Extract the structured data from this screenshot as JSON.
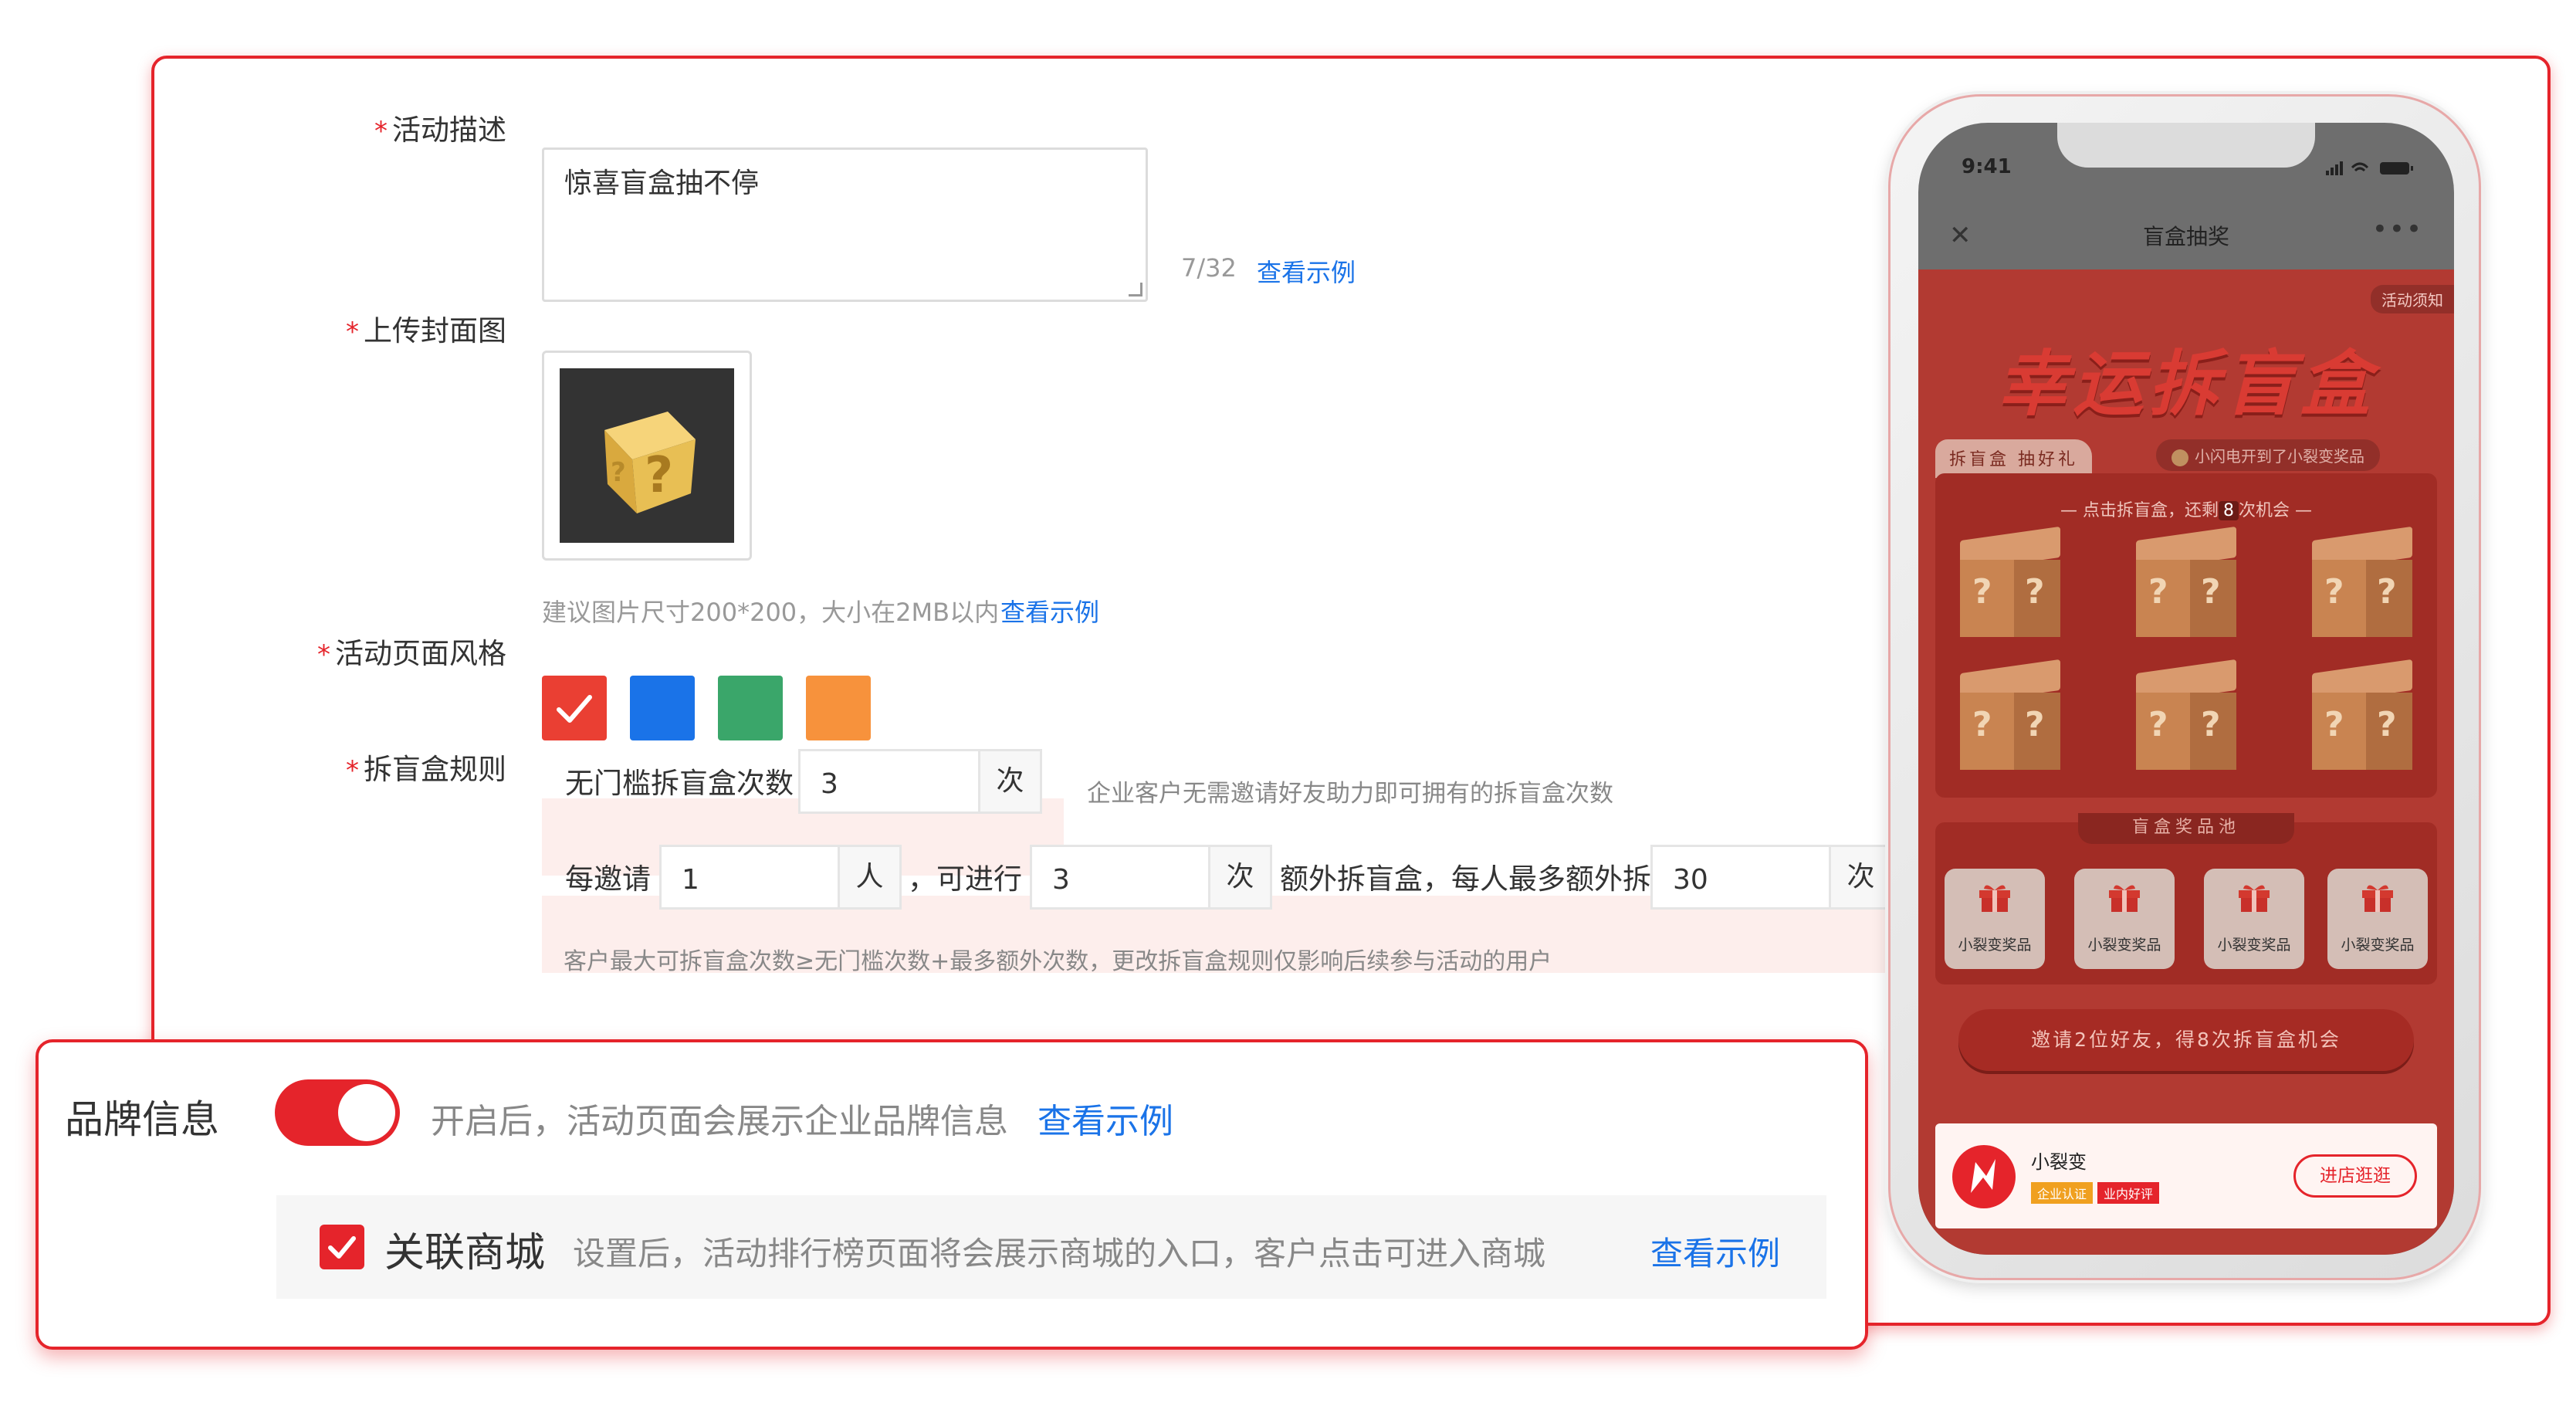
{
  "form": {
    "desc_label": "活动描述",
    "desc_value": "惊喜盲盒抽不停",
    "desc_count": "7/32",
    "view_example": "查看示例",
    "cover_label": "上传封面图",
    "cover_hint": "建议图片尺寸200*200，大小在2MB以内",
    "style_label": "活动页面风格",
    "style_colors": [
      "#ea3f33",
      "#1a73e8",
      "#3aa66a",
      "#f7923c"
    ],
    "rule_label": "拆盲盒规则",
    "required_mark": "*",
    "rule_free_label": "无门槛拆盲盒次数",
    "rule_free_value": "3",
    "unit_times": "次",
    "rule_free_hint": "企业客户无需邀请好友助力即可拥有的拆盲盒次数",
    "rule_invite_label": "每邀请",
    "rule_invite_value": "1",
    "unit_person": "人",
    "rule_can_label": "，可进行",
    "rule_can_value": "3",
    "rule_extra_label": "额外拆盲盒，每人最多额外拆",
    "rule_extra_value": "30",
    "rule_footnote": "客户最大可拆盲盒次数≥无门槛次数+最多额外次数，更改拆盲盒规则仅影响后续参与活动的用户"
  },
  "brand": {
    "title": "品牌信息",
    "toggle_on": true,
    "desc": "开启后，活动页面会展示企业品牌信息",
    "link": "查看示例",
    "mall_checked": true,
    "mall_title": "关联商城",
    "mall_desc": "设置后，活动排行榜页面将会展示商城的入口，客户点击可进入商城",
    "mall_link": "查看示例"
  },
  "phone": {
    "time": "9:41",
    "nav_title": "盲盒抽奖",
    "nav_close": "✕",
    "nav_more": "•••",
    "notice": "活动须知",
    "promo_title": "幸运拆盲盒",
    "tab_label": "拆盲盒 抽好礼",
    "win_msg": "小闪电开到了小裂变奖品",
    "hint_prefix": "— 点击拆盲盒，还剩",
    "hint_count": "8",
    "hint_suffix": "次机会 —",
    "pool_title": "盲盒奖品池",
    "prizes": [
      "小裂变奖品",
      "小裂变奖品",
      "小裂变奖品",
      "小裂变奖品"
    ],
    "invite_btn": "邀请2位好友，得8次拆盲盒机会",
    "shop_name": "小裂变",
    "badge_verified": "企业认证",
    "badge_rated": "业内好评",
    "shop_btn": "进店逛逛"
  }
}
